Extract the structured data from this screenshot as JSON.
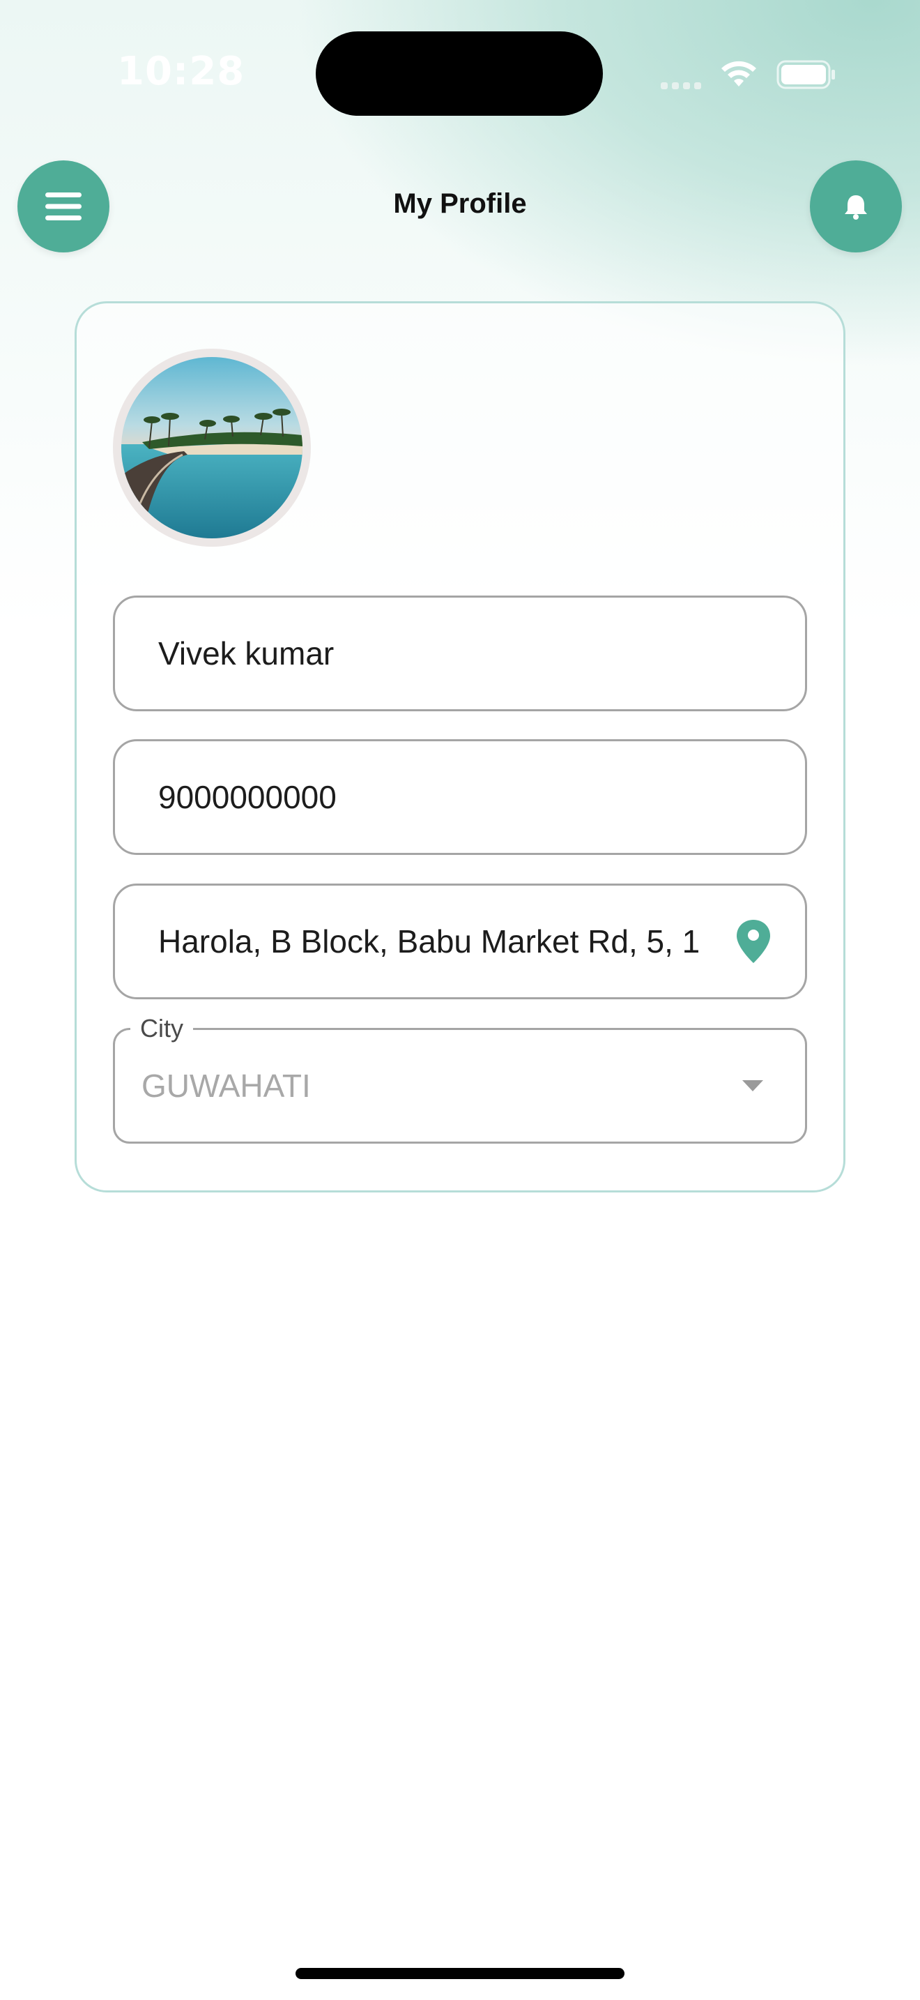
{
  "status_bar": {
    "time": "10:28"
  },
  "header": {
    "title": "My Profile",
    "menu_icon": "hamburger-menu-icon",
    "notification_icon": "bell-icon"
  },
  "profile": {
    "name": "Vivek kumar",
    "phone": "9000000000",
    "address": "Harola, B Block, Babu Market Rd, 5, 1",
    "city_label": "City",
    "city_value": "GUWAHATI"
  },
  "colors": {
    "accent": "#4fad97",
    "card_border": "#b6ddd8",
    "field_border": "#a5a5a5",
    "placeholder_text": "#a8a8a8"
  }
}
